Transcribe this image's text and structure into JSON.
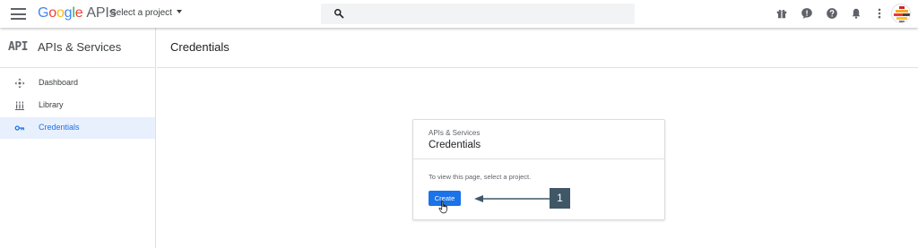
{
  "header": {
    "logo_google": [
      "G",
      "o",
      "o",
      "g",
      "l",
      "e"
    ],
    "logo_product": "APIs",
    "project_selector": "Select a project",
    "icons": [
      "gift-icon",
      "feedback-icon",
      "help-icon",
      "notifications-icon",
      "more-vert-icon"
    ]
  },
  "sidebar": {
    "api_mark": "API",
    "title": "APIs & Services",
    "items": [
      {
        "label": "Dashboard",
        "icon": "dashboard-icon",
        "active": false
      },
      {
        "label": "Library",
        "icon": "library-icon",
        "active": false
      },
      {
        "label": "Credentials",
        "icon": "key-icon",
        "active": true
      }
    ]
  },
  "main": {
    "title": "Credentials",
    "card": {
      "overline": "APIs & Services",
      "title": "Credentials",
      "message": "To view this page, select a project.",
      "button": "Create"
    },
    "callout": "1"
  },
  "colors": {
    "accent": "#1a73e8",
    "active_bg": "#e8f0fe",
    "callout_bg": "#3f5766"
  }
}
